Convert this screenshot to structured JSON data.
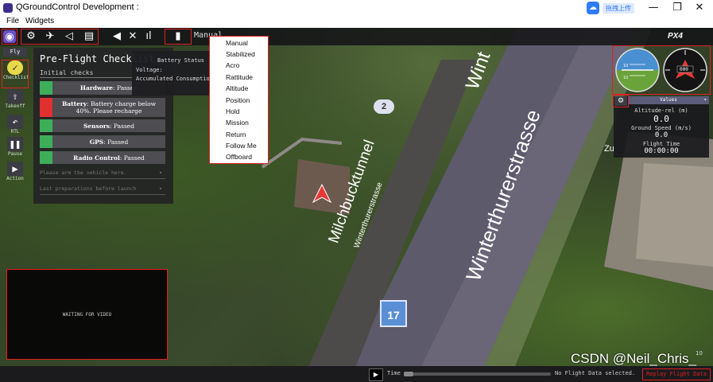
{
  "window": {
    "title": "QGroundControl Development :",
    "upload_label": "拖拽上传",
    "minimize": "—",
    "maximize": "❐",
    "close": "✕"
  },
  "menubar": {
    "file": "File",
    "widgets": "Widgets"
  },
  "toolbar": {
    "mode_text": "Manual",
    "logo": "PX4"
  },
  "left_strip": [
    {
      "label": "Fly"
    },
    {
      "label": "Checklist"
    },
    {
      "label": "Takeoff"
    },
    {
      "label": "RTL"
    },
    {
      "label": "Pause"
    },
    {
      "label": "Action"
    }
  ],
  "checklist": {
    "title": "Pre-Flight Checklist",
    "section": "Initial checks",
    "items": [
      {
        "bold": "Hardware",
        "text": ": Passed",
        "status_color": "#3fae5a"
      },
      {
        "bold": "Battery",
        "text": ": Battery charge below 40%. Please recharge",
        "status_color": "#e03030"
      },
      {
        "bold": "Sensors",
        "text": ": Passed",
        "status_color": "#3fae5a"
      },
      {
        "bold": "GPS",
        "text": ": Passed",
        "status_color": "#3fae5a"
      },
      {
        "bold": "Radio Control",
        "text": ": Passed",
        "status_color": "#3fae5a"
      }
    ],
    "sub_sections": [
      "Please arm the vehicle here.",
      "Last preparations before launch"
    ]
  },
  "battery_tooltip": {
    "title": "Battery Status",
    "voltage_label": "Voltage:",
    "consumption_label": "Accumulated Consumption:"
  },
  "flight_modes": {
    "items": [
      "Manual",
      "Stabilized",
      "Acro",
      "Rattitude",
      "Altitude",
      "Position",
      "Hold",
      "Mission",
      "Return",
      "Follow Me",
      "Offboard"
    ]
  },
  "map": {
    "street_main": "Winterthurerstrasse",
    "street_tunnel": "Milchbucktunnel",
    "street_small": "Winterthurerstrasse",
    "street_top": "Wint",
    "badge_2": "2",
    "badge_17": "17",
    "zoom_text": "Zu",
    "scale_text": "10"
  },
  "instruments": {
    "heading": "000",
    "pitch_a": "10",
    "pitch_b": "10"
  },
  "values": {
    "header": "Values",
    "altitude_label": "Altitude-rel (m)",
    "altitude_value": "0.0",
    "ground_speed_label": "Ground Speed (m/s)",
    "ground_speed_value": "0.0",
    "flight_time_label": "Flight Time",
    "flight_time_value": "00:00:00"
  },
  "video": {
    "message": "WAITING FOR VIDEO"
  },
  "bottom": {
    "play_icon": "▶",
    "time_label": "Time",
    "no_data": "No Flight Data selected.",
    "replay_label": "Replay Flight Data"
  },
  "watermark": "CSDN @Neil_Chris_"
}
